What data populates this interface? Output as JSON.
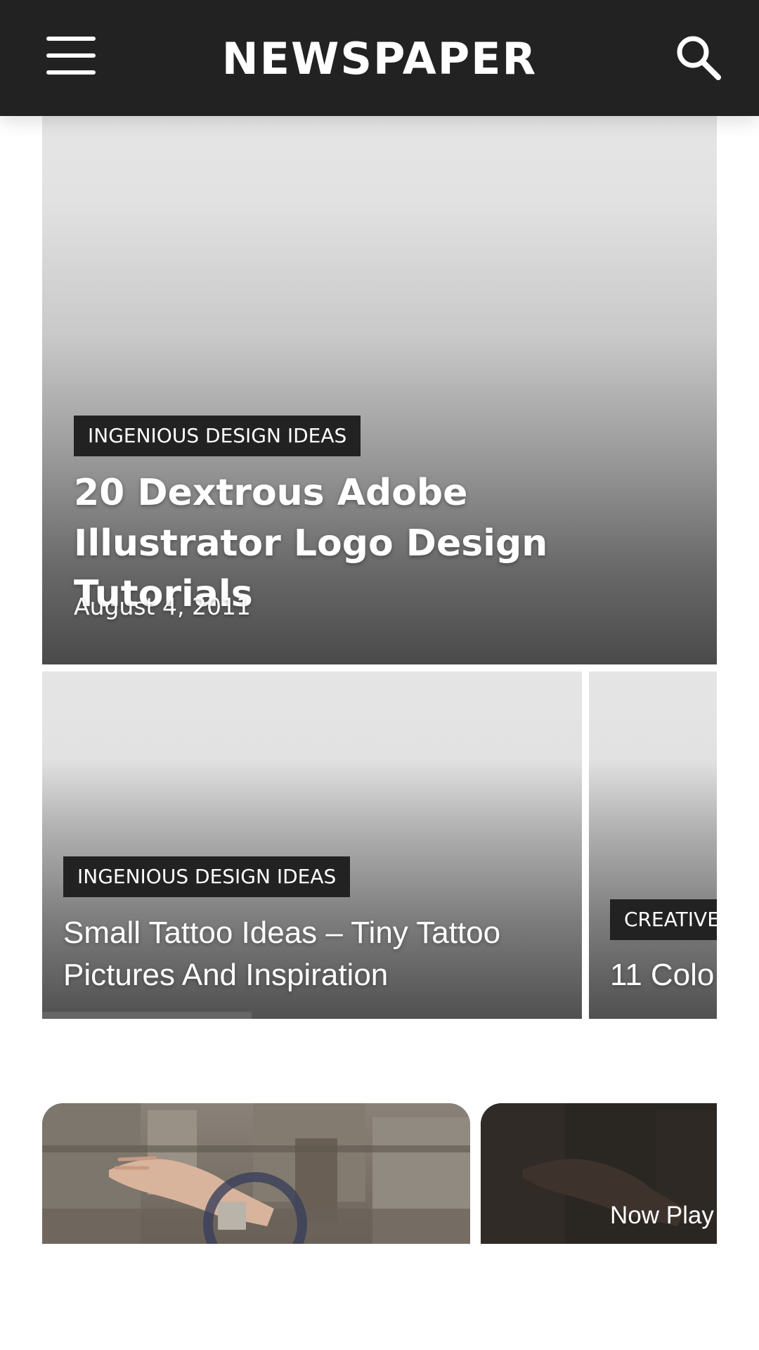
{
  "header": {
    "brand": "NEWSPAPER",
    "menu_icon": "hamburger-menu-icon",
    "search_icon": "search-icon",
    "background": "#222222"
  },
  "hero": {
    "category": "INGENIOUS DESIGN IDEAS",
    "title": "20 Dextrous Adobe Illustrator Logo Design Tutorials",
    "date": "August 4, 2011"
  },
  "slider": {
    "slides": [
      {
        "category": "INGENIOUS DESIGN IDEAS",
        "title": "Small Tattoo Ideas – Tiny Tattoo Pictures And Inspiration"
      },
      {
        "category": "CREATIVE",
        "title": "11 Colo"
      }
    ],
    "progress": 0.31
  },
  "videos": {
    "items": [
      {
        "loading_icon": "loading-spinner-icon"
      },
      {
        "overlay_text": "Now Play"
      }
    ]
  }
}
